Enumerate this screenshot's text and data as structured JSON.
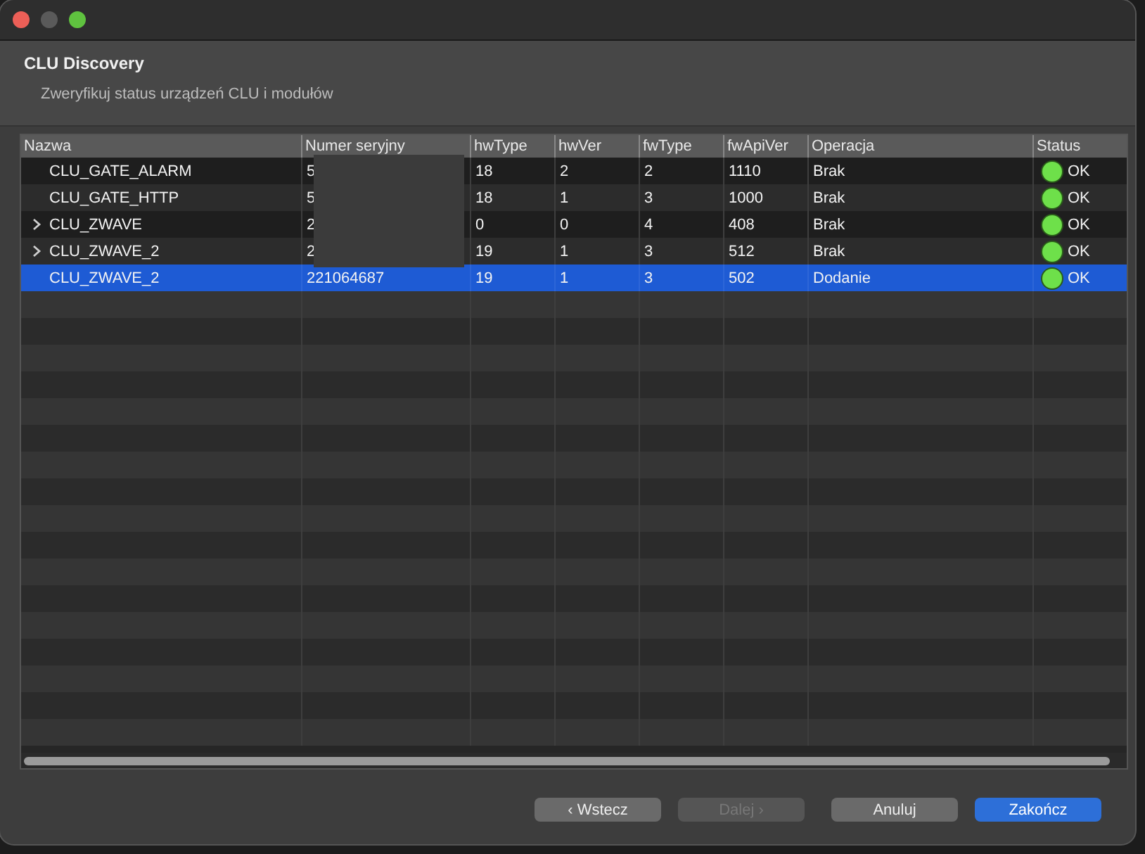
{
  "window": {
    "title": "CLU Discovery",
    "subtitle": "Zweryfikuj status urządzeń CLU i modułów"
  },
  "table": {
    "columns": [
      "Nazwa",
      "Numer seryjny",
      "hwType",
      "hwVer",
      "fwType",
      "fwApiVer",
      "Operacja",
      "Status"
    ],
    "rows": [
      {
        "name": "CLU_GATE_ALARM",
        "serial": "5",
        "serial_redacted": true,
        "hwType": "18",
        "hwVer": "2",
        "fwType": "2",
        "fwApiVer": "1110",
        "operation": "Brak",
        "status": "OK",
        "color": "#6ee04a",
        "selected": false
      },
      {
        "name": "CLU_GATE_HTTP",
        "serial": "5",
        "serial_redacted": true,
        "hwType": "18",
        "hwVer": "1",
        "fwType": "3",
        "fwApiVer": "1000",
        "operation": "Brak",
        "status": "OK",
        "color": "#6ee04a",
        "selected": false
      },
      {
        "name": "CLU_ZWAVE",
        "expanded": false,
        "serial": "2",
        "serial_redacted": true,
        "hwType": "0",
        "hwVer": "0",
        "fwType": "4",
        "fwApiVer": "408",
        "operation": "Brak",
        "status": "OK",
        "color": "#6ee04a",
        "selected": false
      },
      {
        "name": "CLU_ZWAVE_2",
        "expanded": false,
        "serial": "2",
        "serial_redacted": true,
        "hwType": "19",
        "hwVer": "1",
        "fwType": "3",
        "fwApiVer": "512",
        "operation": "Brak",
        "status": "OK",
        "color": "#6ee04a",
        "selected": false
      },
      {
        "name": "CLU_ZWAVE_2",
        "serial": "221064687",
        "serial_redacted": false,
        "hwType": "19",
        "hwVer": "1",
        "fwType": "3",
        "fwApiVer": "502",
        "operation": "Dodanie",
        "status": "OK",
        "color": "#6ee04a",
        "selected": true
      }
    ]
  },
  "buttons": [
    {
      "label": "‹ Wstecz",
      "disabled": false,
      "default": false
    },
    {
      "label": "Dalej ›",
      "disabled": true,
      "default": false
    },
    {
      "label": "Anuluj",
      "disabled": false,
      "default": false
    },
    {
      "label": "Zakończ",
      "disabled": false,
      "default": true
    }
  ]
}
